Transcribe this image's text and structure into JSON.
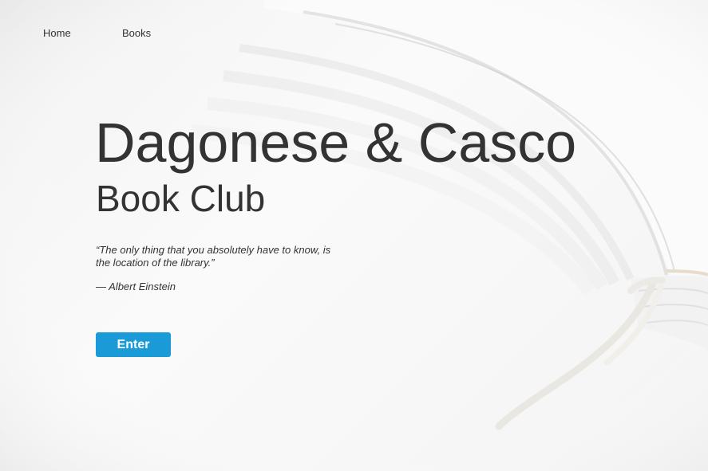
{
  "nav": {
    "items": [
      {
        "label": "Home"
      },
      {
        "label": "Books"
      }
    ]
  },
  "hero": {
    "title": "Dagonese & Casco",
    "subtitle": "Book Club",
    "quote": "“The only thing that you absolutely have to know, is the location of the library.”",
    "attribution": "— Albert Einstein",
    "enter_label": "Enter"
  },
  "colors": {
    "button": "#1a9ad6",
    "text": "#333333",
    "background": "#f6f6f6"
  }
}
